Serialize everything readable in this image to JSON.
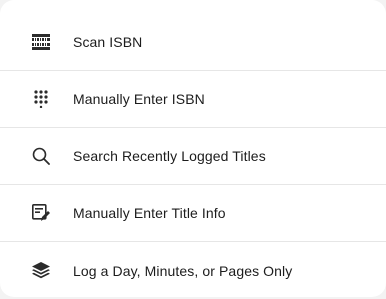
{
  "menu": {
    "items": [
      {
        "label": "Scan ISBN",
        "icon": "barcode-icon"
      },
      {
        "label": "Manually Enter ISBN",
        "icon": "keypad-icon"
      },
      {
        "label": "Search Recently Logged Titles",
        "icon": "search-icon"
      },
      {
        "label": "Manually Enter Title Info",
        "icon": "edit-document-icon"
      },
      {
        "label": "Log a Day, Minutes, or Pages Only",
        "icon": "layers-icon"
      }
    ]
  },
  "colors": {
    "text": "#1c1c1c",
    "icon": "#2b2b2b",
    "divider": "#e6e6e6",
    "background": "#ffffff"
  }
}
